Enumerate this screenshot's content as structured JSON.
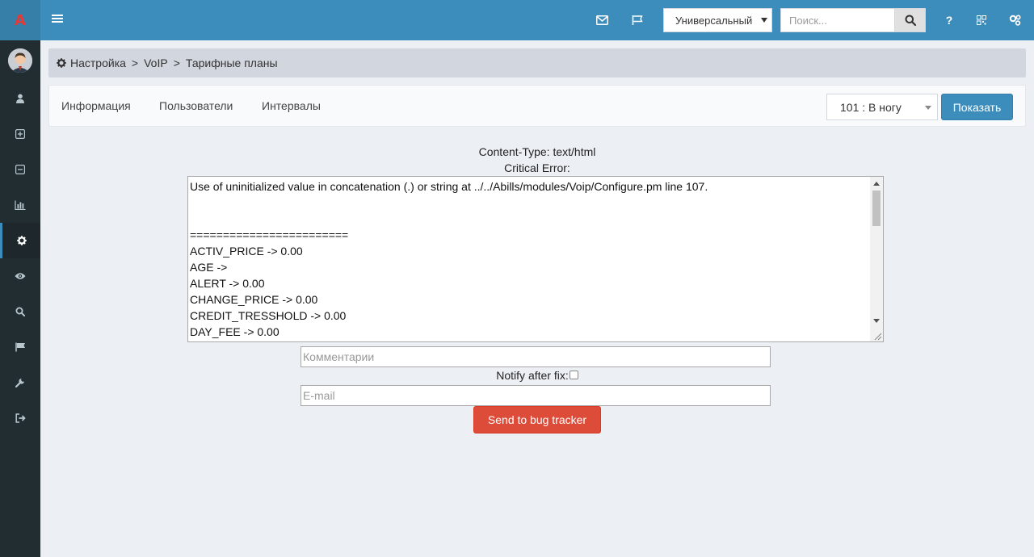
{
  "logo": {
    "letter": "A",
    "color": "#e53935"
  },
  "header": {
    "color": "#3c8dbc",
    "icons": [
      "menu-icon",
      "envelope-icon",
      "flag-icon",
      "search-icon",
      "question-icon",
      "qrcode-icon",
      "users-cog-icon"
    ],
    "select_value": "Универсальный",
    "search_placeholder": "Поиск...",
    "help_label": "?"
  },
  "sidebar": {
    "items": [
      {
        "name": "user-icon"
      },
      {
        "name": "plus-square-icon"
      },
      {
        "name": "minus-square-icon"
      },
      {
        "name": "bar-chart-icon"
      },
      {
        "name": "gear-icon",
        "active": true
      },
      {
        "name": "eye-icon"
      },
      {
        "name": "search-icon"
      },
      {
        "name": "flag-icon"
      },
      {
        "name": "wrench-icon"
      },
      {
        "name": "sign-out-icon"
      }
    ]
  },
  "breadcrumb": {
    "items": [
      "Настройка",
      "VoIP",
      "Тарифные планы"
    ],
    "separator": ">"
  },
  "tabs": {
    "items": [
      {
        "label": "Информация"
      },
      {
        "label": "Пользователи"
      },
      {
        "label": "Интервалы"
      }
    ],
    "plan_select_value": "101 : В ногу",
    "show_label": "Показать"
  },
  "error": {
    "content_type": "Content-Type: text/html",
    "critical": "Critical Error:",
    "lines": [
      "Use of uninitialized value in concatenation (.) or string at ../../Abills/modules/Voip/Configure.pm line 107.",
      "",
      "",
      "========================",
      "ACTIV_PRICE -> 0.00",
      "AGE ->",
      "ALERT -> 0.00",
      "CHANGE_PRICE -> 0.00",
      "CREDIT_TRESSHOLD -> 0.00",
      "DAY_FEE -> 0.00"
    ],
    "comment_placeholder": "Комментарии",
    "notify_label": "Notify after fix:",
    "email_placeholder": "E-mail",
    "bug_button_label": "Send to bug tracker",
    "bug_button_color": "#dd4b39"
  }
}
